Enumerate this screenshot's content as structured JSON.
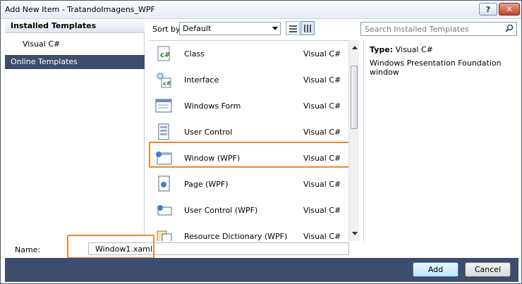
{
  "window": {
    "title": "Add New Item - TratandoImagens_WPF",
    "help_label": "?",
    "close_label": "✕"
  },
  "categories": {
    "installed_label": "Installed Templates",
    "items": [
      "Visual C#"
    ],
    "online_label": "Online Templates"
  },
  "toolbar": {
    "sort_label": "Sort by:",
    "sort_value": "Default",
    "search_placeholder": "Search Installed Templates"
  },
  "templates": [
    {
      "name": "Class",
      "language": "Visual C#",
      "icon": "class-icon"
    },
    {
      "name": "Interface",
      "language": "Visual C#",
      "icon": "interface-icon"
    },
    {
      "name": "Windows Form",
      "language": "Visual C#",
      "icon": "windows-form-icon"
    },
    {
      "name": "User Control",
      "language": "Visual C#",
      "icon": "user-control-icon"
    },
    {
      "name": "Window (WPF)",
      "language": "Visual C#",
      "icon": "wpf-window-icon",
      "selected": true
    },
    {
      "name": "Page (WPF)",
      "language": "Visual C#",
      "icon": "wpf-page-icon"
    },
    {
      "name": "User Control (WPF)",
      "language": "Visual C#",
      "icon": "wpf-user-control-icon"
    },
    {
      "name": "Resource Dictionary (WPF)",
      "language": "Visual C#",
      "icon": "resource-dictionary-icon"
    }
  ],
  "details": {
    "type_label": "Type:",
    "type_value": "Visual C#",
    "description": "Windows Presentation Foundation window"
  },
  "name_field": {
    "label": "Name:",
    "value": "Window1.xaml"
  },
  "buttons": {
    "add": "Add",
    "cancel": "Cancel"
  },
  "colors": {
    "accent_dark": "#3d4d6e",
    "highlight": "#f0872e"
  }
}
